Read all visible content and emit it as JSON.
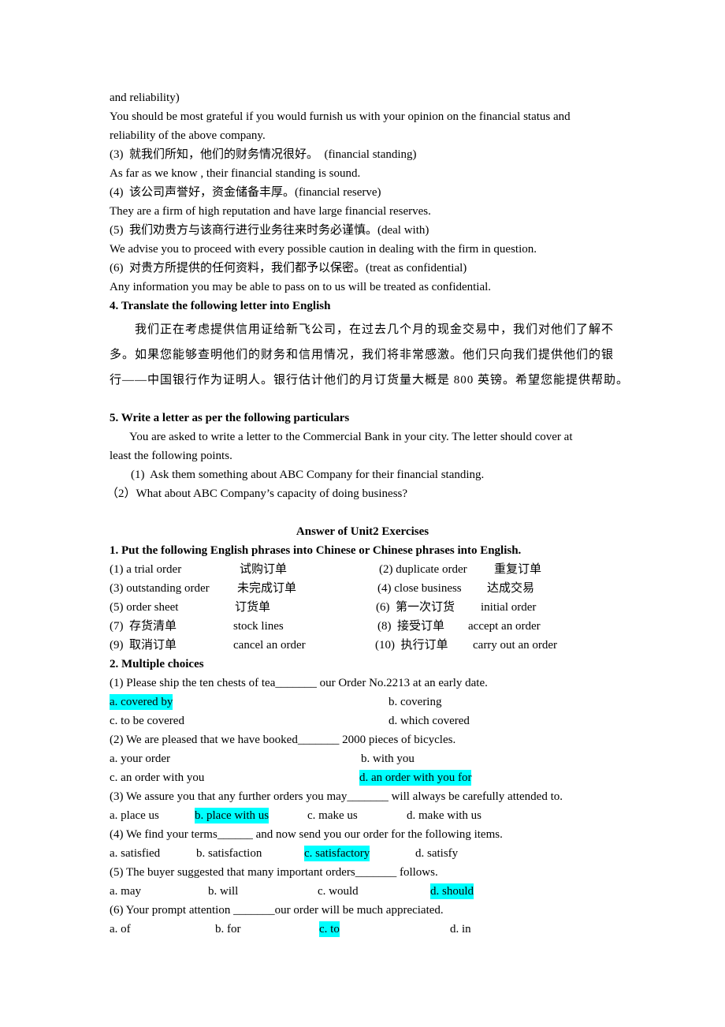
{
  "document": {
    "intro_lines": [
      "and reliability)",
      "You should be most grateful if you would furnish us with your opinion on the financial status and",
      "reliability of the above company.",
      "(3)  就我们所知，他们的财务情况很好。  (financial standing)",
      "As far as we know , their financial standing is sound.",
      "(4)  该公司声誉好，资金储备丰厚。(financial reserve)",
      "They are a firm of high reputation and have large financial reserves.",
      "(5)  我们劝贵方与该商行进行业务往来时务必谨慎。(deal with)",
      "We advise you to proceed with every possible caution in dealing with the firm in question.",
      "(6)  对贵方所提供的任何资料，我们都予以保密。(treat as confidential)",
      "Any information you may be able to pass on to us will be treated as confidential."
    ],
    "section4": {
      "heading": "4. Translate the following letter into English",
      "paragraph_lines": [
        "我们正在考虑提供信用证给新飞公司，在过去几个月的现金交易中，我们对他们了解不",
        "多。如果您能够查明他们的财务和信用情况，我们将非常感激。他们只向我们提供他们的银",
        "行——中国银行作为证明人。银行估计他们的月订货量大概是 800 英镑。希望您能提供帮助。"
      ]
    },
    "section5": {
      "heading": "5. Write a letter as per the following particulars",
      "lines": [
        "You are asked to write a letter to the Commercial Bank in your city. The letter should cover at",
        "least the following points.",
        "(1)  Ask them something about ABC Company for their financial standing.",
        "（2）What about ABC Company’s capacity of doing business?"
      ]
    },
    "answer_title": "Answer of Unit2 Exercises",
    "part1": {
      "heading": "1. Put the following English phrases into Chinese or Chinese phrases into English.",
      "rows": [
        {
          "left_q": "(1) a trial order",
          "left_a": "试购订单",
          "right_q": "(2) duplicate order",
          "right_a": "重复订单"
        },
        {
          "left_q": "(3) outstanding order",
          "left_a": "未完成订单",
          "right_q": "(4) close business",
          "right_a": "达成交易"
        },
        {
          "left_q": "(5) order sheet",
          "left_a": "订货单",
          "right_q": "(6)  第一次订货",
          "right_a": "initial order"
        },
        {
          "left_q": "(7)  存货清单",
          "left_a": "stock lines",
          "right_q": "(8)  接受订单",
          "right_a": "accept an order"
        },
        {
          "left_q": "(9)  取消订单",
          "left_a": "cancel an order",
          "right_q": "(10)  执行订单",
          "right_a": "carry out an order"
        }
      ]
    },
    "part2": {
      "heading": "2. Multiple choices",
      "questions": [
        {
          "q": "(1) Please ship the ten chests of tea_______ our Order No.2213 at an early date.",
          "options": [
            "a. covered by",
            "b. covering",
            "c. to be covered",
            "d. which covered"
          ],
          "answer": "a"
        },
        {
          "q": "(2) We are pleased that we have booked_______ 2000 pieces of bicycles.",
          "options": [
            "a. your order",
            "b. with you",
            "c. an order with you",
            "d. an order with you for"
          ],
          "answer": "d"
        },
        {
          "q": "(3) We assure you that any further orders you may_______ will always be carefully attended to.",
          "options": [
            "a. place us",
            "b. place with us",
            "c. make us",
            "d. make with us"
          ],
          "answer": "b"
        },
        {
          "q": "(4) We find your terms______ and now send you our order for the following items.",
          "options": [
            "a. satisfied",
            "b. satisfaction",
            "c. satisfactory",
            "d. satisfy"
          ],
          "answer": "c"
        },
        {
          "q": "(5) The buyer suggested that many important orders_______ follows.",
          "options": [
            "a. may",
            "b. will",
            "c. would",
            "d. should"
          ],
          "answer": "d"
        },
        {
          "q": "(6) Your prompt attention _______our order will be much appreciated.",
          "options": [
            "a. of",
            "b. for",
            "c. to",
            "d. in"
          ],
          "answer": "c"
        }
      ]
    },
    "colors": {
      "answer_highlight": "#00ffff"
    }
  }
}
